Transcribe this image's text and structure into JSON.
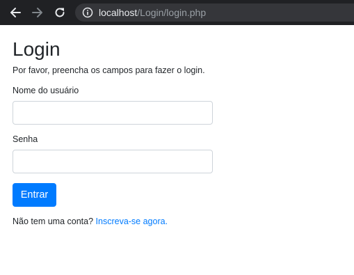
{
  "browser": {
    "url_host": "localhost",
    "url_path": "/Login/login.php",
    "icons": {
      "back": "arrow-left-icon",
      "forward": "arrow-right-icon",
      "reload": "reload-icon",
      "info": "info-icon"
    },
    "colors": {
      "toolbar": "#202124",
      "address_bar": "#35363a"
    }
  },
  "page": {
    "title": "Login",
    "subtitle": "Por favor, preencha os campos para fazer o login.",
    "username_label": "Nome do usuário",
    "username_value": "",
    "password_label": "Senha",
    "password_value": "",
    "submit_label": "Entrar",
    "signup_prompt": "Não tem uma conta?",
    "signup_link": "Inscreva-se agora.",
    "colors": {
      "primary": "#007bff",
      "text": "#212529"
    }
  }
}
